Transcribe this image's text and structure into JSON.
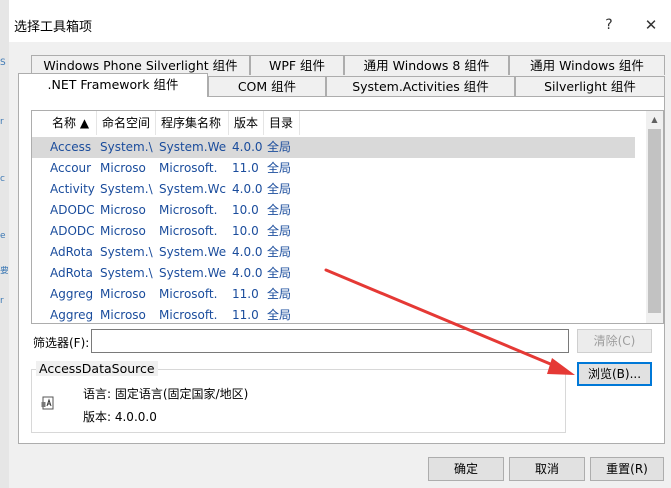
{
  "window": {
    "title": "选择工具箱项",
    "help_label": "?",
    "close_label": "✕"
  },
  "left_strip_marks": [
    "S",
    "r",
    "c",
    "e",
    "要",
    "r"
  ],
  "tabs_top": [
    {
      "label": "Windows Phone Silverlight 组件"
    },
    {
      "label": "WPF 组件"
    },
    {
      "label": "通用 Windows 8 组件"
    },
    {
      "label": "通用 Windows 组件"
    }
  ],
  "tabs_bottom": [
    {
      "label": ".NET Framework 组件",
      "active": true
    },
    {
      "label": "COM 组件"
    },
    {
      "label": "System.Activities 组件"
    },
    {
      "label": "Silverlight 组件"
    }
  ],
  "table": {
    "columns": [
      {
        "label": "名称 ▲"
      },
      {
        "label": "命名空间"
      },
      {
        "label": "程序集名称"
      },
      {
        "label": "版本"
      },
      {
        "label": "目录"
      }
    ],
    "rows": [
      {
        "name": "Access",
        "ns": "System.\\",
        "asm": "System.We",
        "ver": "4.0.0",
        "dir": "全局",
        "selected": true
      },
      {
        "name": "Accour",
        "ns": "Microso",
        "asm": "Microsoft.",
        "ver": "11.0",
        "dir": "全局"
      },
      {
        "name": "Activity",
        "ns": "System.\\",
        "asm": "System.Wc",
        "ver": "4.0.0",
        "dir": "全局"
      },
      {
        "name": "ADODC",
        "ns": "Microso",
        "asm": "Microsoft.",
        "ver": "10.0",
        "dir": "全局"
      },
      {
        "name": "ADODC",
        "ns": "Microso",
        "asm": "Microsoft.",
        "ver": "10.0",
        "dir": "全局"
      },
      {
        "name": "AdRota",
        "ns": "System.\\",
        "asm": "System.We",
        "ver": "4.0.0",
        "dir": "全局"
      },
      {
        "name": "AdRota",
        "ns": "System.\\",
        "asm": "System.We",
        "ver": "4.0.0",
        "dir": "全局"
      },
      {
        "name": "Aggreg",
        "ns": "Microso",
        "asm": "Microsoft.",
        "ver": "11.0",
        "dir": "全局"
      },
      {
        "name": "Aggreg",
        "ns": "Microso",
        "asm": "Microsoft.",
        "ver": "11.0",
        "dir": "全局"
      }
    ]
  },
  "filter": {
    "label": "筛选器(F):",
    "value": "",
    "clear_label": "清除(C)"
  },
  "details": {
    "group_title": "AccessDataSource",
    "language_line": "语言:  固定语言(固定国家/地区)",
    "version_line": "版本:  4.0.0.0",
    "browse_label": "浏览(B)..."
  },
  "footer": {
    "ok_label": "确定",
    "cancel_label": "取消",
    "reset_label": "重置(R)"
  },
  "colors": {
    "annotation_arrow": "#e53935",
    "link_text": "#1a4c9c"
  }
}
